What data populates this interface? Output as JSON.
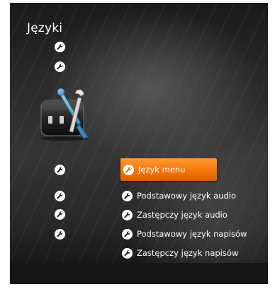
{
  "window": {
    "title": "Języki"
  },
  "side_icons": [
    {
      "icon": "wrench-icon"
    },
    {
      "icon": "wrench-icon"
    },
    {
      "icon": "wrench-icon"
    },
    {
      "icon": "wrench-icon"
    },
    {
      "icon": "wrench-icon"
    },
    {
      "icon": "wrench-icon"
    }
  ],
  "illustration": {
    "icon": "toolbox-icon"
  },
  "menu": {
    "selected_index": 0,
    "items": [
      {
        "label": "Język menu",
        "icon": "wrench-icon"
      },
      {
        "label": "Podstawowy język audio",
        "icon": "wrench-icon"
      },
      {
        "label": "Zastępczy język audio",
        "icon": "wrench-icon"
      },
      {
        "label": "Podstawowy język napisów",
        "icon": "wrench-icon"
      },
      {
        "label": "Zastępczy język napisów",
        "icon": "wrench-icon"
      }
    ]
  },
  "colors": {
    "highlight": "#f57a0b",
    "background": "#2d2d2d",
    "text": "#ffffff"
  }
}
